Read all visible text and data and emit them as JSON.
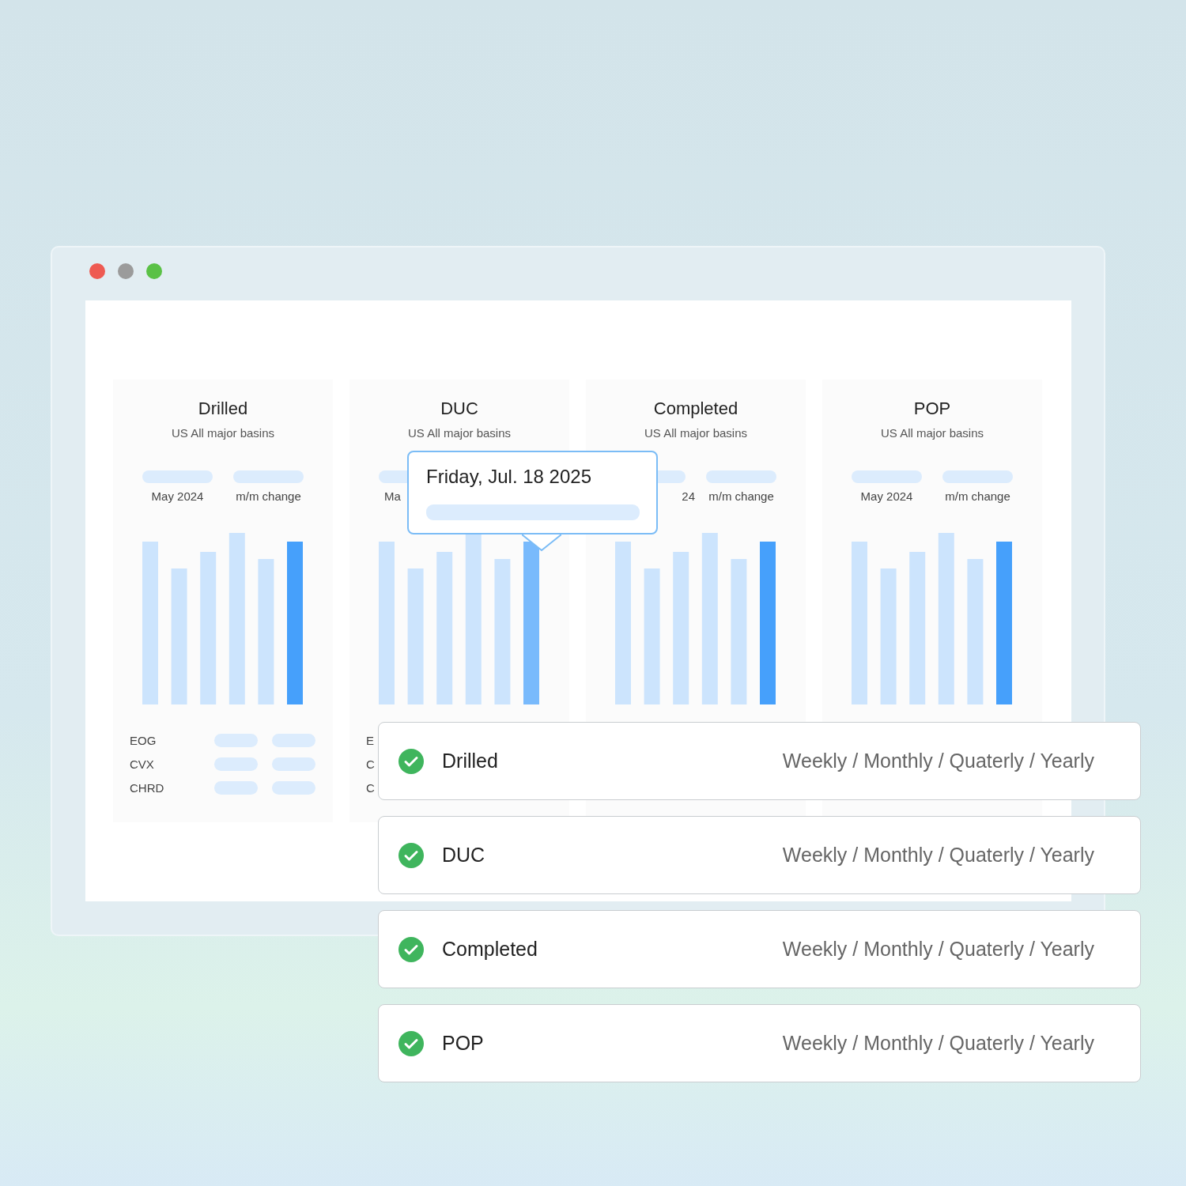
{
  "cards": [
    {
      "title": "Drilled",
      "subtitle": "US All major basins",
      "hovered": false,
      "stats": [
        {
          "label": "May 2024",
          "kind": "whole"
        },
        {
          "label": "m/m change",
          "kind": "whole"
        }
      ],
      "rows": [
        {
          "label": "EOG",
          "kind": "full"
        },
        {
          "label": "CVX",
          "kind": "full"
        },
        {
          "label": "CHRD",
          "kind": "full"
        }
      ]
    },
    {
      "title": "DUC",
      "subtitle": "US All major basins",
      "hovered": true,
      "stats": [
        {
          "label": "Ma",
          "kind": "head"
        }
      ],
      "rows": [
        {
          "label": "E",
          "kind": "bare"
        },
        {
          "label": "C",
          "kind": "bare"
        },
        {
          "label": "C",
          "kind": "bare"
        }
      ]
    },
    {
      "title": "Completed",
      "subtitle": "US All major basins",
      "hovered": false,
      "stats": [
        {
          "label": "24",
          "kind": "tail"
        },
        {
          "label": "m/m change",
          "kind": "whole"
        }
      ]
    },
    {
      "title": "POP",
      "subtitle": "US All major basins",
      "hovered": false,
      "stats": [
        {
          "label": "May 2024",
          "kind": "whole"
        },
        {
          "label": "m/m change",
          "kind": "whole"
        }
      ]
    }
  ],
  "tooltip": {
    "date": "Friday, Jul. 18 2025"
  },
  "metrics": [
    {
      "label": "Drilled",
      "checked": true,
      "periods": "Weekly / Monthly / Quaterly / Yearly"
    },
    {
      "label": "DUC",
      "checked": true,
      "periods": "Weekly / Monthly / Quaterly / Yearly"
    },
    {
      "label": "Completed",
      "checked": true,
      "periods": "Weekly / Monthly / Quaterly / Yearly"
    },
    {
      "label": "POP",
      "checked": true,
      "periods": "Weekly / Monthly / Quaterly / Yearly"
    }
  ]
}
